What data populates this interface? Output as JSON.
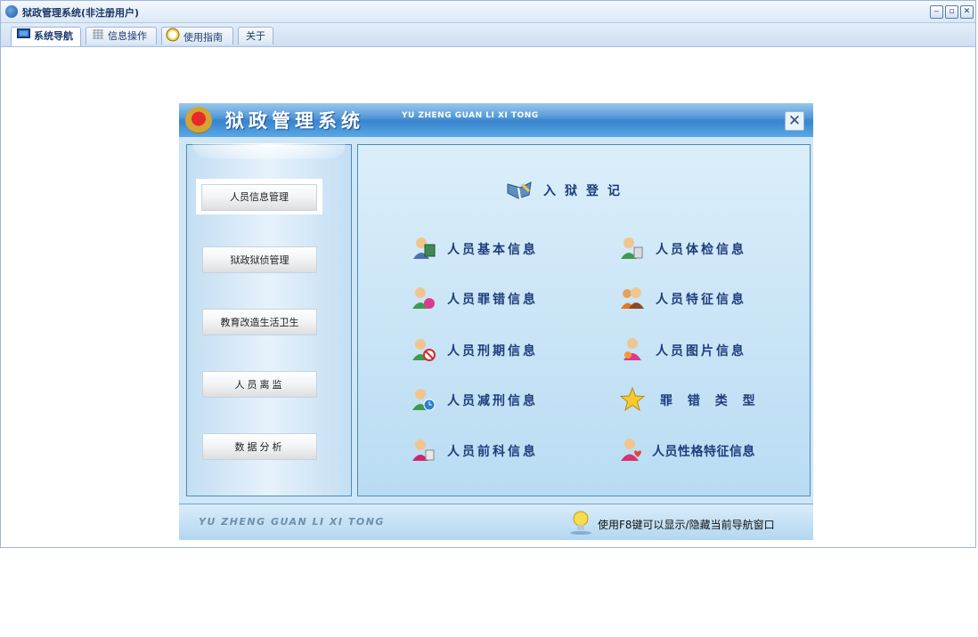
{
  "window": {
    "title": "狱政管理系统(非注册用户)",
    "controls": {
      "minimize": "‒",
      "restore": "▫",
      "close": "✕"
    }
  },
  "tabs": [
    {
      "label": "系统导航",
      "icon": "monitor-icon",
      "active": true
    },
    {
      "label": "信息操作",
      "icon": "grid-icon",
      "active": false
    },
    {
      "label": "使用指南",
      "icon": "clock-icon",
      "active": false
    },
    {
      "label": "关于",
      "icon": "",
      "active": false
    }
  ],
  "nav": {
    "title": "狱政管理系统",
    "pinyin": "YU ZHENG GUAN LI XI TONG",
    "close_label": "✕",
    "left_menu": [
      {
        "label": "人员信息管理",
        "selected": true
      },
      {
        "label": "狱政狱侦管理",
        "selected": false
      },
      {
        "label": "教育改造生活卫生",
        "selected": false
      },
      {
        "label": "人员离监",
        "selected": false
      },
      {
        "label": "数据分析",
        "selected": false
      }
    ],
    "section_title": "入狱登记",
    "items": [
      {
        "label": "人员基本信息",
        "icon": "person-book-icon"
      },
      {
        "label": "人员体检信息",
        "icon": "person-check-icon"
      },
      {
        "label": "人员罪错信息",
        "icon": "person-pink-icon"
      },
      {
        "label": "人员特征信息",
        "icon": "person-orange-icon"
      },
      {
        "label": "人员刑期信息",
        "icon": "person-no-icon"
      },
      {
        "label": "人员图片信息",
        "icon": "person-pink2-icon"
      },
      {
        "label": "人员减刑信息",
        "icon": "person-clock-icon"
      },
      {
        "label": "罪 错 类 型",
        "icon": "star-icon"
      },
      {
        "label": "人员前科信息",
        "icon": "person-red-icon"
      },
      {
        "label": "人员性格特征信息",
        "icon": "person-heart-icon"
      }
    ],
    "footer": {
      "pinyin": "YU ZHENG GUAN LI XI TONG",
      "tip": "使用F8键可以显示/隐藏当前导航窗口"
    }
  },
  "colors": {
    "accent": "#3a86cf",
    "panel": "#cfe6f6",
    "text": "#1f3d7c"
  }
}
